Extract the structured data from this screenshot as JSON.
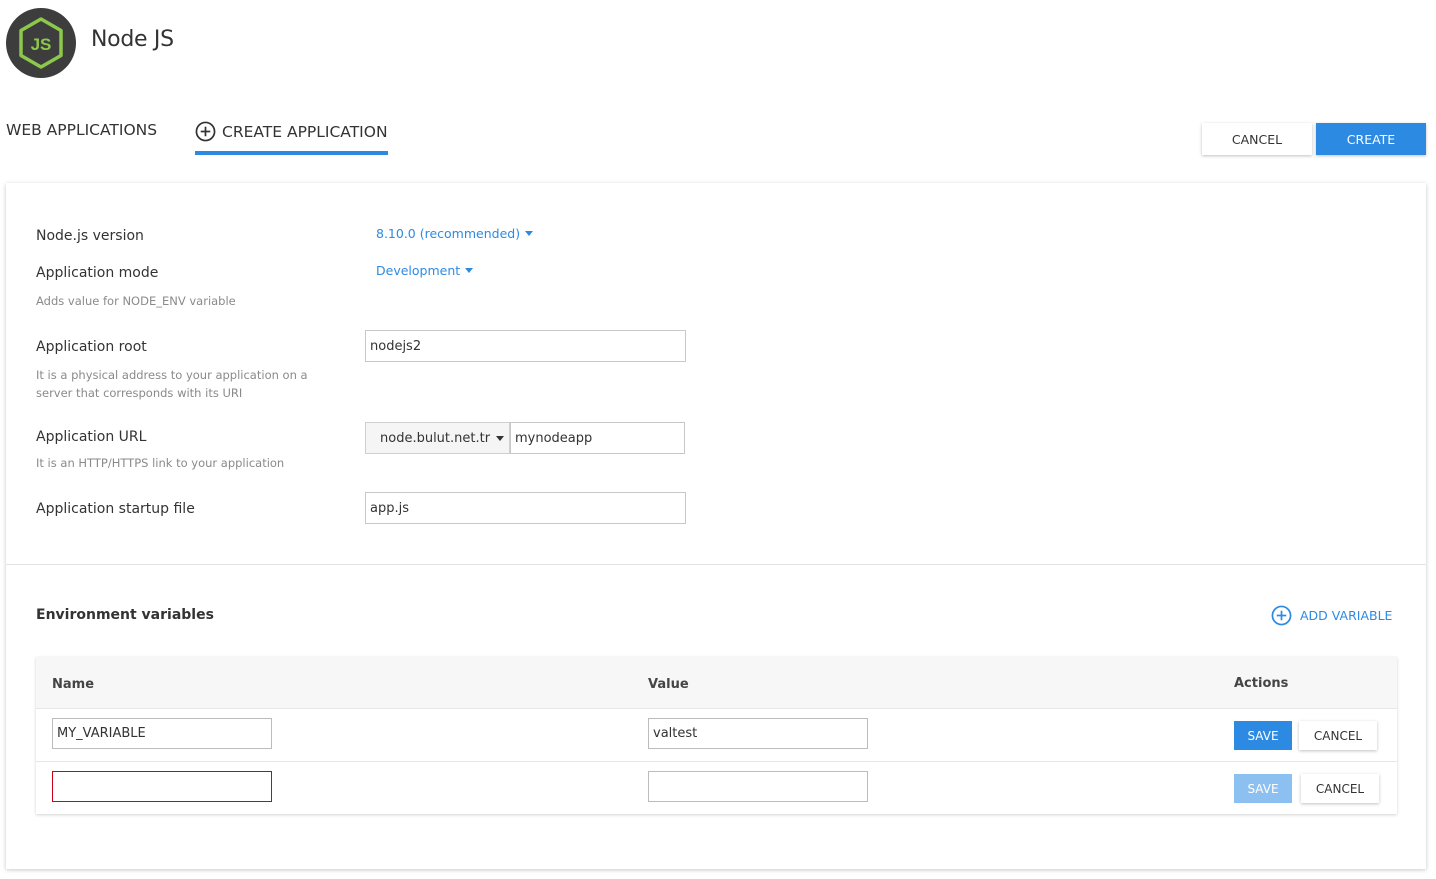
{
  "app": {
    "title": "Node JS",
    "logo_text": "JS"
  },
  "tabs": {
    "web_applications": "WEB APPLICATIONS",
    "create_application": "CREATE APPLICATION"
  },
  "toolbar": {
    "cancel_label": "CANCEL",
    "create_label": "CREATE"
  },
  "form": {
    "node_version": {
      "label": "Node.js version",
      "value": "8.10.0 (recommended)"
    },
    "app_mode": {
      "label": "Application mode",
      "value": "Development",
      "hint": "Adds value for NODE_ENV variable"
    },
    "app_root": {
      "label": "Application root",
      "value": "nodejs2",
      "hint": "It is a physical address to your application on a server that corresponds with its URI"
    },
    "app_url": {
      "label": "Application URL",
      "domain": "node.bulut.net.tr",
      "path": "mynodeapp",
      "hint": "It is an HTTP/HTTPS link to your application"
    },
    "startup_file": {
      "label": "Application startup file",
      "value": "app.js"
    }
  },
  "env": {
    "title": "Environment variables",
    "add_label": "ADD VARIABLE",
    "columns": {
      "name": "Name",
      "value": "Value",
      "actions": "Actions"
    },
    "rows": [
      {
        "name": "MY_VARIABLE",
        "value": "valtest",
        "save": "SAVE",
        "cancel": "CANCEL"
      },
      {
        "name": "",
        "value": "",
        "save": "SAVE",
        "cancel": "CANCEL"
      }
    ]
  },
  "colors": {
    "accent": "#2d8ae3",
    "logo_bg": "#3d3d3d",
    "logo_green": "#8cc84b",
    "error_border": "#d0021b"
  }
}
